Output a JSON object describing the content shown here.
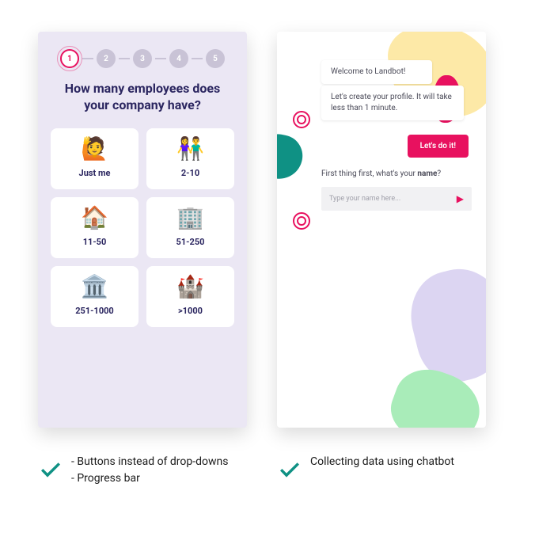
{
  "steps": {
    "labels": [
      "1",
      "2",
      "3",
      "4",
      "5"
    ],
    "active": 1
  },
  "question": "How many employees does your company have?",
  "options": [
    {
      "emoji": "🙋",
      "label": "Just me"
    },
    {
      "emoji": "👫",
      "label": "2-10"
    },
    {
      "emoji": "🏠",
      "label": "11-50"
    },
    {
      "emoji": "🏢",
      "label": "51-250"
    },
    {
      "emoji": "🏛️",
      "label": "251-1000"
    },
    {
      "emoji": "🏰",
      "label": ">1000"
    }
  ],
  "chat": {
    "welcome": "Welcome to Landbot!",
    "intro": "Let's create your profile. It will take less than 1 minute.",
    "cta": "Let's do it!",
    "prompt_prefix": "First thing first, what's your ",
    "prompt_bold": "name",
    "prompt_suffix": "?",
    "placeholder": "Type your name here..."
  },
  "captions": {
    "left": [
      "- Buttons instead of drop-downs",
      "- Progress bar"
    ],
    "right": [
      "Collecting data using chatbot"
    ]
  },
  "colors": {
    "accent": "#e8115f",
    "teal": "#0f9184"
  }
}
